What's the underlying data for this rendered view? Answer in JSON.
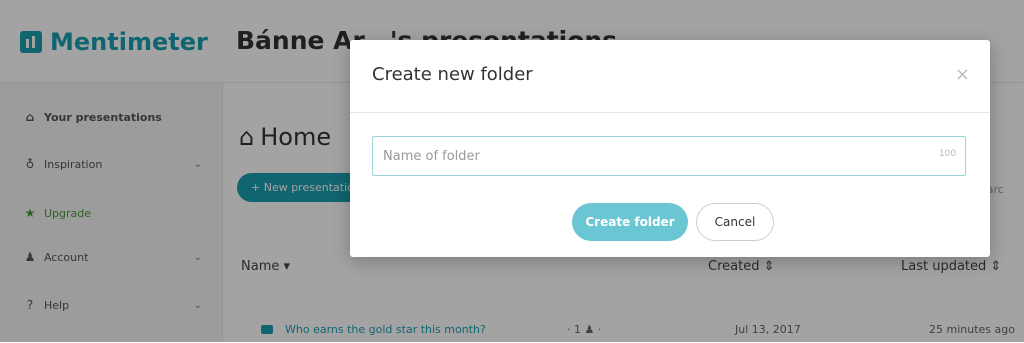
{
  "app": {
    "logo_text": "Mentimeter",
    "page_title": "Bánne Ar…'s presentations"
  },
  "sidebar": {
    "items": [
      {
        "label": "Your presentations",
        "icon": "home-icon"
      },
      {
        "label": "Inspiration",
        "icon": "lightbulb-icon",
        "chevron": "⌄"
      },
      {
        "label": "Upgrade",
        "icon": "star-icon"
      },
      {
        "label": "Account",
        "icon": "user-icon",
        "chevron": "⌄"
      },
      {
        "label": "Help",
        "icon": "question-icon",
        "chevron": "⌄"
      }
    ]
  },
  "main": {
    "heading": "Home",
    "new_button": "+ New presentation",
    "search_fragment": "Searc",
    "columns": {
      "name": "Name ▾",
      "created": "Created ⇕",
      "updated": "Last updated ⇕"
    },
    "row": {
      "title": "Who earns the gold star this month?",
      "meta": "· 1 ♟ ·",
      "created": "Jul 13, 2017",
      "updated": "25 minutes ago"
    }
  },
  "modal": {
    "title": "Create new folder",
    "close": "×",
    "input_placeholder": "Name of folder",
    "input_value": "",
    "char_limit": "100",
    "create_label": "Create folder",
    "cancel_label": "Cancel"
  },
  "colors": {
    "brand": "#1a9fb0",
    "primary_button": "#6bc6d4",
    "upgrade": "#4a9a3a"
  }
}
